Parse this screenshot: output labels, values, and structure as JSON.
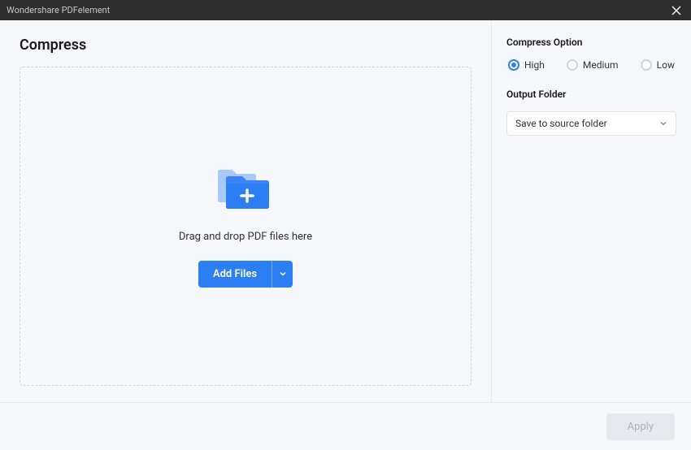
{
  "titlebar": {
    "app_title": "Wondershare PDFelement"
  },
  "main": {
    "page_title": "Compress",
    "drop_zone": {
      "hint_text": "Drag and drop PDF files here",
      "add_button_label": "Add Files"
    }
  },
  "sidebar": {
    "compress_option": {
      "heading": "Compress Option",
      "options": [
        {
          "label": "High",
          "selected": true
        },
        {
          "label": "Medium",
          "selected": false
        },
        {
          "label": "Low",
          "selected": false
        }
      ]
    },
    "output_folder": {
      "heading": "Output Folder",
      "selected": "Save to source folder"
    }
  },
  "footer": {
    "apply_label": "Apply"
  }
}
